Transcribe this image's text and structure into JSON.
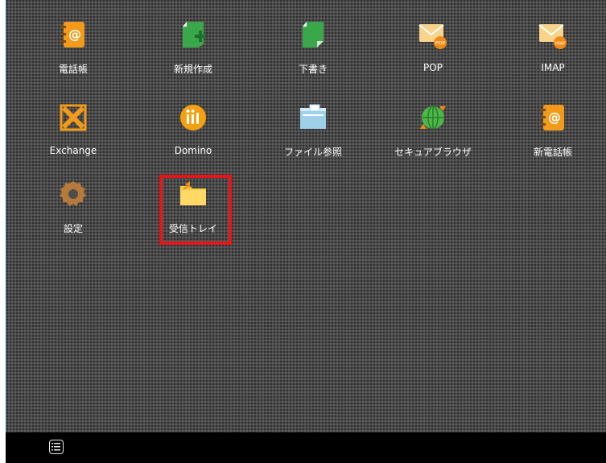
{
  "apps": [
    {
      "label": "電話帳",
      "icon": "phonebook-icon"
    },
    {
      "label": "新規作成",
      "icon": "new-document-icon"
    },
    {
      "label": "下書き",
      "icon": "draft-icon"
    },
    {
      "label": "POP",
      "icon": "pop-mail-icon",
      "badge": "POP"
    },
    {
      "label": "IMAP",
      "icon": "imap-mail-icon",
      "badge": "IMAP"
    },
    {
      "label": "Exchange",
      "icon": "exchange-icon"
    },
    {
      "label": "Domino",
      "icon": "domino-icon"
    },
    {
      "label": "ファイル参照",
      "icon": "file-browse-icon"
    },
    {
      "label": "セキュアブラウザ",
      "icon": "secure-browser-icon"
    },
    {
      "label": "新電話帳",
      "icon": "new-phonebook-icon"
    },
    {
      "label": "設定",
      "icon": "settings-icon"
    },
    {
      "label": "受信トレイ",
      "icon": "inbox-folder-icon"
    }
  ],
  "taskbar": {
    "menu_icon": "list-menu-icon"
  },
  "colors": {
    "highlight": "#e6141b",
    "background": "#4d4d4d",
    "taskbar": "#000000"
  }
}
